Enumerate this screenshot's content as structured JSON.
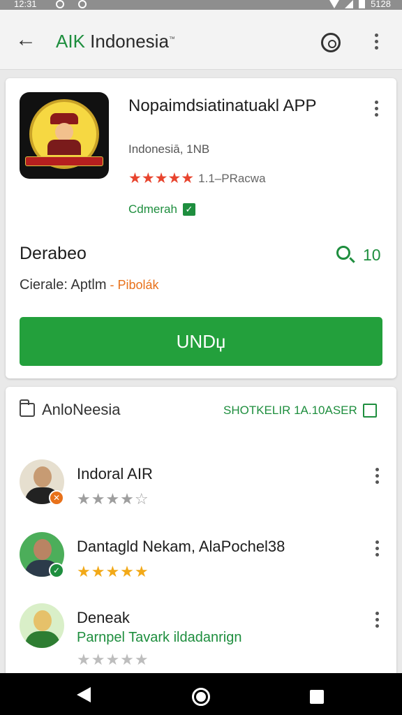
{
  "status_bar": {
    "time": "12:31",
    "battery": "5128"
  },
  "app_bar": {
    "back_icon": "arrow-left-icon",
    "title_prefix": "AIK",
    "title_main": " Indonesia",
    "title_sup": "™"
  },
  "app": {
    "name": "Nopaimdsiatinatuakl APP",
    "developer": "Indonesiā, 1NB",
    "stars": "★★★★★",
    "rating_count": "1.1–PRacwa",
    "badge": "Cdmerah"
  },
  "details": {
    "section_title": "Derabeo",
    "search_count": "10",
    "meta_label": "Cierale: Aptlm",
    "meta_sep": " - ",
    "meta_value": "Pibolák"
  },
  "install_button": {
    "label": "UNDџ"
  },
  "reviews": {
    "header": "AnloNeesia",
    "link": "SHOTKELIR 1A.10ASER",
    "items": [
      {
        "name": "Indoral AIR",
        "subtitle": "",
        "stars": "★★★★☆",
        "star_color": "#9e9e9e",
        "avatar_bg": "#e6dfcf",
        "skin": "#c79b73",
        "shirt": "#222222",
        "badge_bg": "#e8711a",
        "badge_icon": "✕"
      },
      {
        "name": "Dantagld Nekam, AlaPochel38",
        "subtitle": "",
        "stars": "★★★★★",
        "star_color": "#f2a918",
        "avatar_bg": "#4cae5a",
        "skin": "#b98463",
        "shirt": "#2c3b4a",
        "badge_bg": "#1e8e3e",
        "badge_icon": "✓"
      },
      {
        "name": "Deneak",
        "subtitle": "Parnpel Tavark ildadanrign",
        "stars": "★★★★★",
        "star_color": "#bdbdbd",
        "avatar_bg": "#d9efc8",
        "skin": "#e6c16a",
        "shirt": "#2e7d32",
        "badge_bg": "",
        "badge_icon": ""
      }
    ]
  }
}
